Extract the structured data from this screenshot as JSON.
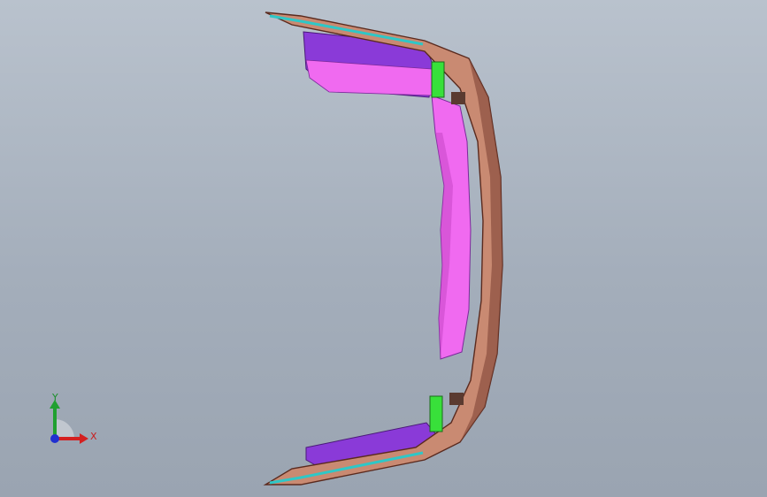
{
  "viewport": {
    "background_top": "#b9c2cd",
    "background_bottom": "#9aa4b1"
  },
  "model": {
    "colors": {
      "bumper_skin": "#c98a72",
      "bumper_shadow": "#8a4f3e",
      "support_magenta": "#f06af0",
      "support_purple": "#8a3ad8",
      "bracket_green": "#38e03a",
      "edge_cyan": "#2fc7c7"
    }
  },
  "triad": {
    "x_label": "X",
    "y_label": "Y",
    "x_color": "#d42020",
    "y_color": "#20a030",
    "z_color": "#2030d0"
  }
}
